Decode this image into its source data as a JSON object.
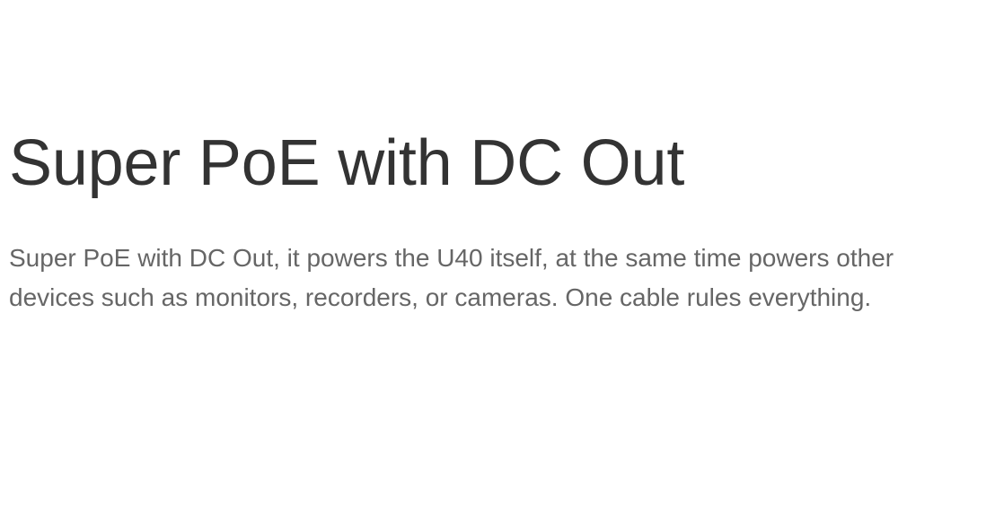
{
  "feature": {
    "title": "Super PoE with DC Out",
    "description": "Super PoE with DC Out, it powers the U40 itself, at the same time powers other devices such as monitors, recorders, or cameras. One cable rules everything."
  },
  "colors": {
    "background": "#ffffff",
    "heading": "#333333",
    "body_text": "#666666"
  }
}
